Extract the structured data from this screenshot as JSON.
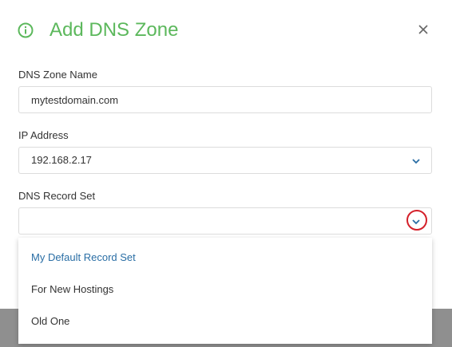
{
  "dialog": {
    "title": "Add DNS Zone",
    "icon": "info-icon",
    "close_icon": "close-icon",
    "accent_color": "#5cb85c"
  },
  "form": {
    "zone_name": {
      "label": "DNS Zone Name",
      "value": "mytestdomain.com"
    },
    "ip_address": {
      "label": "IP Address",
      "value": "192.168.2.17"
    },
    "record_set": {
      "label": "DNS Record Set",
      "value": ""
    }
  },
  "dropdown": {
    "options": [
      {
        "label": "My Default Record Set",
        "selected": true
      },
      {
        "label": "For New Hostings",
        "selected": false
      },
      {
        "label": "Old One",
        "selected": false
      }
    ],
    "selected_color": "#2a6ea5"
  },
  "highlight_color": "#d4202a"
}
